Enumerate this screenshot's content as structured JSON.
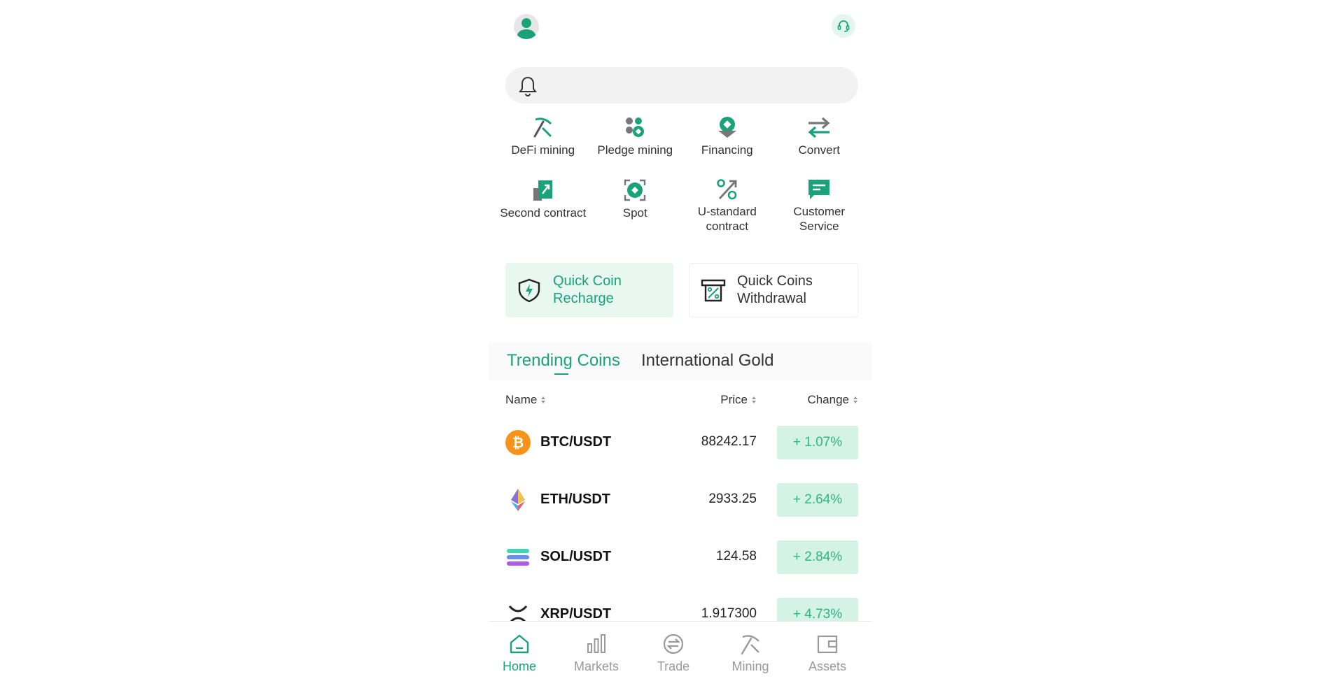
{
  "colors": {
    "accent": "#1aa37a",
    "up_bg": "#d4f2e5",
    "up_text": "#2bb784"
  },
  "quick_menu": [
    {
      "label": "DeFi mining",
      "icon": "pickaxe-icon"
    },
    {
      "label": "Pledge mining",
      "icon": "coins-icon"
    },
    {
      "label": "Financing",
      "icon": "financing-icon"
    },
    {
      "label": "Convert",
      "icon": "convert-arrows-icon"
    },
    {
      "label": "Second contract",
      "icon": "second-contract-icon"
    },
    {
      "label": "Spot",
      "icon": "spot-icon"
    },
    {
      "label": "U-standard contract",
      "icon": "percent-arrow-icon"
    },
    {
      "label": "Customer Service",
      "icon": "chat-icon"
    }
  ],
  "deposit": {
    "recharge_label": "Quick Coin Recharge",
    "withdraw_label": "Quick Coins Withdrawal"
  },
  "tabs": [
    "Trending Coins",
    "International Gold"
  ],
  "table": {
    "headers": {
      "name": "Name",
      "price": "Price",
      "change": "Change"
    },
    "rows": [
      {
        "pair": "BTC/USDT",
        "price": "88242.17",
        "change": "+ 1.07%",
        "icon": "btc-icon"
      },
      {
        "pair": "ETH/USDT",
        "price": "2933.25",
        "change": "+ 2.64%",
        "icon": "eth-icon"
      },
      {
        "pair": "SOL/USDT",
        "price": "124.58",
        "change": "+ 2.84%",
        "icon": "sol-icon"
      },
      {
        "pair": "XRP/USDT",
        "price": "1.917300",
        "change": "+ 4.73%",
        "icon": "xrp-icon"
      }
    ]
  },
  "bottom_nav": [
    {
      "label": "Home",
      "icon": "home-icon",
      "active": true
    },
    {
      "label": "Markets",
      "icon": "bar-chart-icon"
    },
    {
      "label": "Trade",
      "icon": "trade-icon"
    },
    {
      "label": "Mining",
      "icon": "pickaxe-icon"
    },
    {
      "label": "Assets",
      "icon": "wallet-icon"
    }
  ]
}
